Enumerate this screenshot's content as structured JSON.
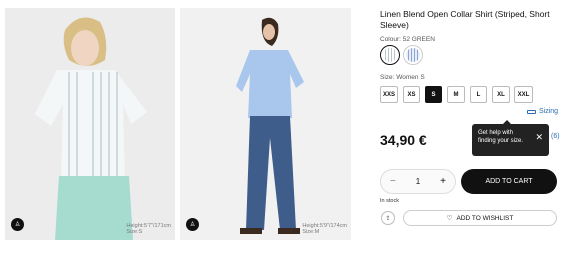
{
  "gallery": {
    "photo1_caption": [
      "Height:5'7\"/171cm",
      "Size:S"
    ],
    "photo2_caption": [
      "Height:5'9\"/174cm",
      "Size:M"
    ]
  },
  "product": {
    "title": "Linen Blend Open Collar Shirt (Striped, Short Sleeve)",
    "colour_label": "Colour: 52 GREEN",
    "size_label": "Size: Women S",
    "sizes": [
      "XXS",
      "XS",
      "S",
      "M",
      "L",
      "XL",
      "XXL"
    ],
    "selected_size": "S",
    "sizing_link": "Sizing",
    "price": "34,90 €",
    "review_count": "(6)",
    "stock": "In stock"
  },
  "tooltip": {
    "line1": "Get help with",
    "line2": "finding your size.",
    "close": "✕"
  },
  "cart": {
    "quantity": "1",
    "minus": "−",
    "plus": "+",
    "add_label": "ADD TO CART",
    "wishlist_label": "ADD TO WISHLIST"
  }
}
